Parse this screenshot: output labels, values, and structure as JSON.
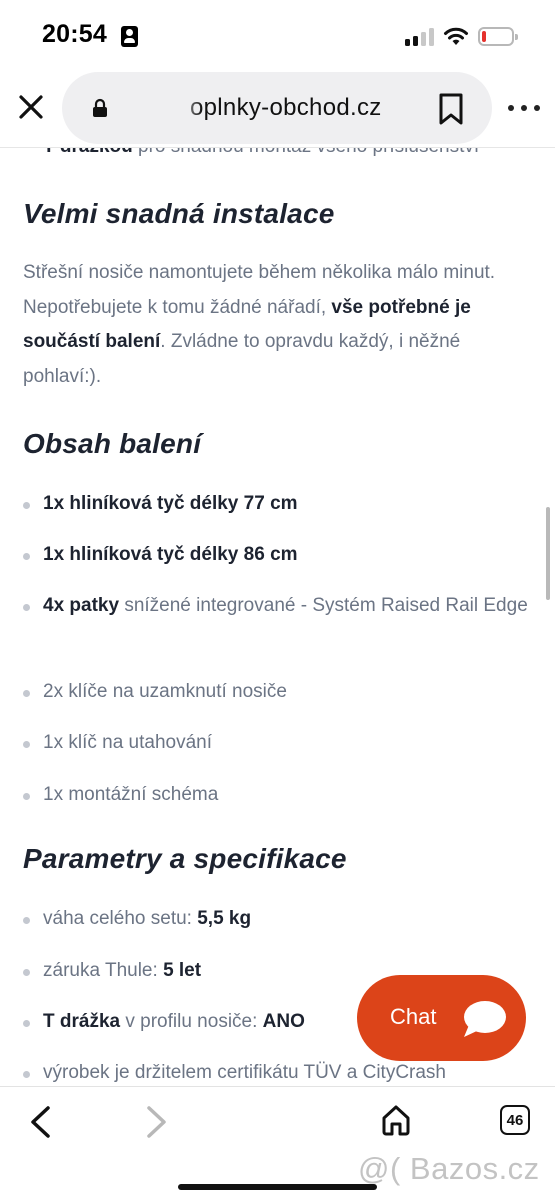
{
  "status_bar": {
    "time": "20:54",
    "battery_level": 0.08,
    "signal_bars_active": 2,
    "signal_bars_total": 4
  },
  "browser": {
    "url": "oplnky-obchod.cz",
    "close_icon": "close-icon",
    "lock_icon": "lock-icon",
    "bookmark_icon": "bookmark-icon",
    "share_icon": "share-icon",
    "more_icon": "more-icon"
  },
  "content": {
    "cut_line_bold": "T-drážkou",
    "cut_line_text": " pro snadnou montáž všeho příslušenství",
    "sections": [
      {
        "heading": "Velmi snadná instalace"
      },
      {
        "heading": "Obsah balení"
      },
      {
        "heading": "Parametry a specifikace"
      }
    ],
    "install_paragraph": {
      "text_1": "Střešní nosiče namontujete během několika málo minut. Nepotřebujete k tomu žádné nářadí, ",
      "bold": "vše potřebné je součástí balení",
      "text_2": ". Zvládne to opravdu každý, i něžné pohlaví:)."
    },
    "package_items": [
      {
        "bold": "1x hliníková tyč délky 77 cm",
        "text": ""
      },
      {
        "bold": "1x hliníková tyč délky 86 cm",
        "text": ""
      },
      {
        "bold": "4x patky",
        "text": " snížené integrované - Systém Raised Rail Edge"
      },
      {
        "bold": "",
        "text": "2x klíče na uzamknutí nosiče"
      },
      {
        "bold": "",
        "text": "1x klíč na utahování"
      },
      {
        "bold": "",
        "text": "1x montážní schéma"
      }
    ],
    "specs": [
      {
        "label": "váha celého setu: ",
        "value": "5,5 kg"
      },
      {
        "label": "záruka Thule: ",
        "value": "5 let"
      },
      {
        "label_bold": "T drážka",
        "label": " v profilu nosiče: ",
        "value": "ANO"
      },
      {
        "label": "výrobek je držitelem certifikátu TÜV a CityCrash",
        "value": ""
      }
    ]
  },
  "chat": {
    "label": "Chat",
    "icon": "chat-bubble-icon",
    "color": "#dc4419"
  },
  "bottom_bar": {
    "tab_count": "46",
    "back_icon": "back-arrow-icon",
    "forward_icon": "forward-arrow-icon",
    "home_icon": "home-icon"
  },
  "watermark": "@( Bazos.cz"
}
